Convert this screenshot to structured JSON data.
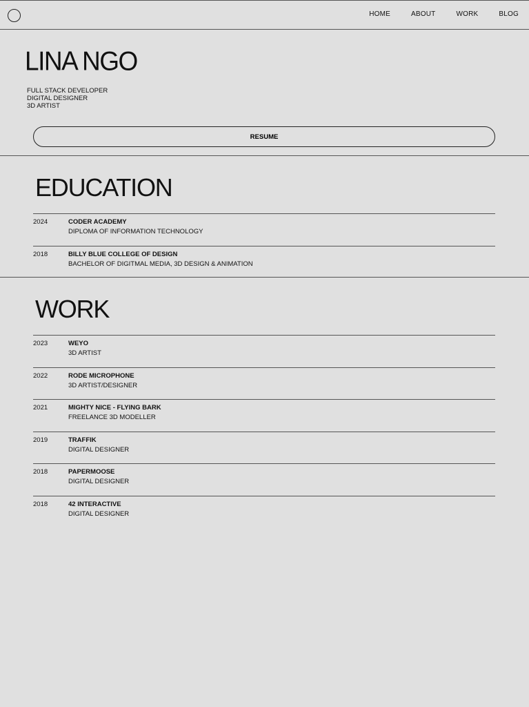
{
  "nav": {
    "links": [
      "HOME",
      "ABOUT",
      "WORK",
      "BLOG"
    ]
  },
  "hero": {
    "name": "LINA NGO",
    "roles": [
      "FULL STACK DEVELOPER",
      "DIGITAL DESIGNER",
      "3D ARTIST"
    ],
    "resume_label": "RESUME"
  },
  "education": {
    "title": "EDUCATION",
    "entries": [
      {
        "year": "2024",
        "title": "CODER ACADEMY",
        "subtitle": "DIPLOMA OF INFORMATION TECHNOLOGY"
      },
      {
        "year": "2018",
        "title": "BILLY BLUE COLLEGE OF DESIGN",
        "subtitle": "BACHELOR OF DIGITMAL MEDIA, 3D DESIGN & ANIMATION"
      }
    ]
  },
  "work": {
    "title": "WORK",
    "entries": [
      {
        "year": "2023",
        "title": "WEYO",
        "subtitle": "3D ARTIST"
      },
      {
        "year": "2022",
        "title": "RODE MICROPHONE",
        "subtitle": "3D ARTIST/DESIGNER"
      },
      {
        "year": "2021",
        "title": "MIGHTY NICE - FLYING BARK",
        "subtitle": "FREELANCE 3D MODELLER"
      },
      {
        "year": "2019",
        "title": "TRAFFIK",
        "subtitle": "DIGITAL DESIGNER"
      },
      {
        "year": "2018",
        "title": "PAPERMOOSE",
        "subtitle": "DIGITAL DESIGNER"
      },
      {
        "year": "2018",
        "title": "42 INTERACTIVE",
        "subtitle": "DIGITAL DESIGNER"
      }
    ]
  }
}
